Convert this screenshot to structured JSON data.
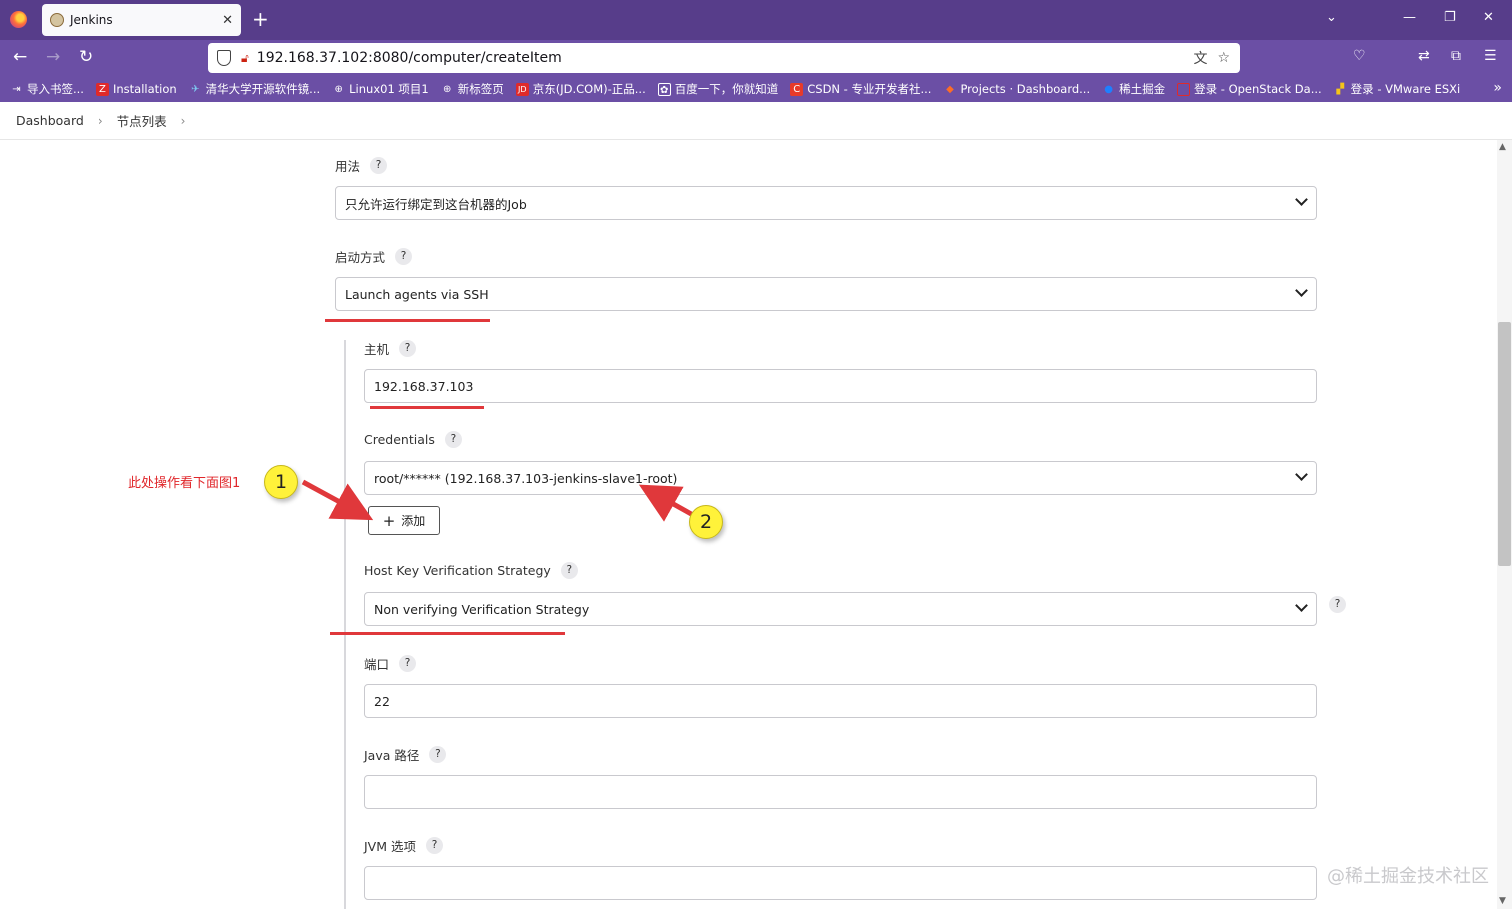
{
  "browser": {
    "tab_title": "Jenkins",
    "tab_close": "✕",
    "new_tab": "+",
    "url": "192.168.37.102:8080/computer/createItem",
    "bookmarks": [
      {
        "label": "导入书签...",
        "icon": "import-icon"
      },
      {
        "label": "Installation",
        "icon": "Z"
      },
      {
        "label": "清华大学开源软件镜...",
        "icon": "tuna-icon"
      },
      {
        "label": "Linux01 项目1",
        "icon": "globe-icon"
      },
      {
        "label": "新标签页",
        "icon": "globe-icon"
      },
      {
        "label": "京东(JD.COM)-正品...",
        "icon": "JD"
      },
      {
        "label": "百度一下，你就知道",
        "icon": "baidu-icon"
      },
      {
        "label": "CSDN - 专业开发者社...",
        "icon": "C"
      },
      {
        "label": "Projects · Dashboard...",
        "icon": "gitlab-icon"
      },
      {
        "label": "稀土掘金",
        "icon": "juejin-icon"
      },
      {
        "label": "登录 - OpenStack Da...",
        "icon": "openstack-icon"
      },
      {
        "label": "登录 - VMware ESXi",
        "icon": "vmware-icon"
      }
    ]
  },
  "breadcrumb": {
    "items": [
      "Dashboard",
      "节点列表"
    ],
    "sep": "›"
  },
  "form": {
    "usage_label": "用法",
    "usage_value": "只允许运行绑定到这台机器的Job",
    "launch_label": "启动方式",
    "launch_value": "Launch agents via SSH",
    "host_label": "主机",
    "host_value": "192.168.37.103",
    "credentials_label": "Credentials",
    "credentials_value": "root/****** (192.168.37.103-jenkins-slave1-root)",
    "add_button": "添加",
    "add_plus": "+",
    "hkvs_label": "Host Key Verification Strategy",
    "hkvs_value": "Non verifying Verification Strategy",
    "port_label": "端口",
    "port_value": "22",
    "java_label": "Java 路径",
    "java_value": "",
    "jvm_label": "JVM 选项",
    "jvm_value": "",
    "help": "?"
  },
  "annotations": {
    "note": "此处操作看下面图1",
    "bubble1": "1",
    "bubble2": "2",
    "color": "#e0383b"
  },
  "watermark": "@稀土掘金技术社区"
}
